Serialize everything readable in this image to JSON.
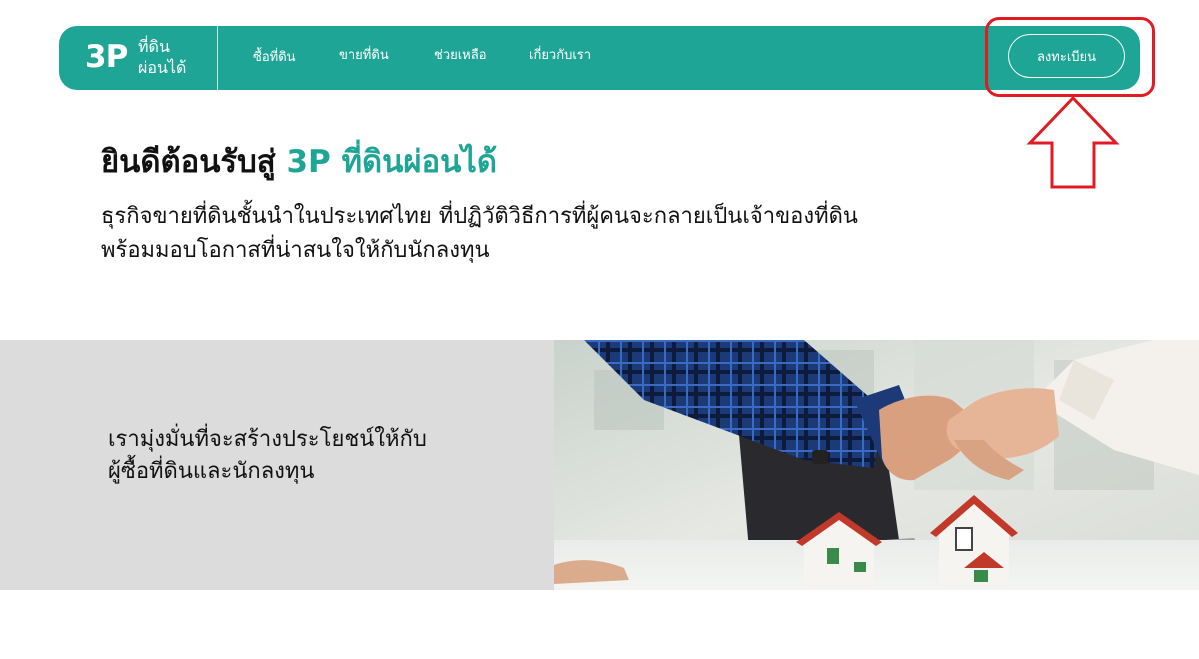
{
  "brand": {
    "logo_mark": "3P",
    "name_line1": "ที่ดิน",
    "name_line2": "ผ่อนได้"
  },
  "nav": {
    "items": [
      {
        "label": "ซื้อที่ดิน"
      },
      {
        "label": "ขายที่ดิน"
      },
      {
        "label": "ช่วยเหลือ"
      },
      {
        "label": "เกี่ยวกับเรา"
      }
    ],
    "register_label": "ลงทะเบียน"
  },
  "hero": {
    "title_prefix": "ยินดีต้อนรับสู่ ",
    "title_accent": "3P ที่ดินผ่อนได้",
    "subtitle_line1": "ธุรกิจขายที่ดินชั้นนำในประเทศไทย ที่ปฏิวัติวิธีการที่ผู้คนจะกลายเป็นเจ้าของที่ดิน",
    "subtitle_line2": "พร้อมมอบโอกาสที่น่าสนใจให้กับนักลงทุน"
  },
  "banner": {
    "text_line1": "เรามุ่งมั่นที่จะสร้างประโยชน์ให้กับ",
    "text_line2": "ผู้ซื้อที่ดินและนักลงทุน",
    "image_icon": "handshake-houses-photo"
  },
  "colors": {
    "brand": "#1fa596",
    "highlight": "#e11b22",
    "banner_bg": "#dcdcdc"
  }
}
